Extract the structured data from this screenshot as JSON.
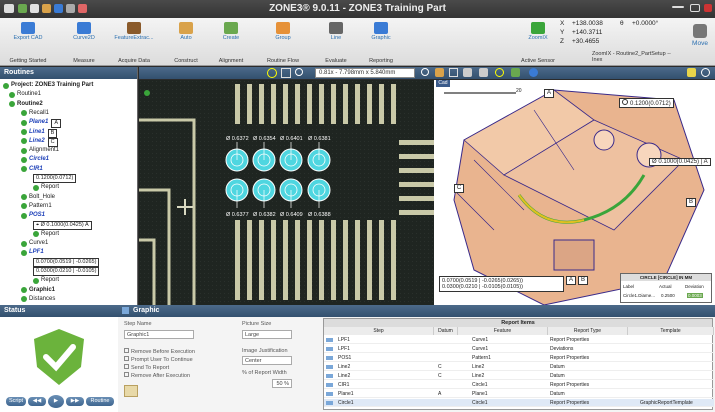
{
  "app": {
    "title": "ZONE3® 9.0.11 - ZONE3 Training Part"
  },
  "ribbon": {
    "groups": [
      {
        "icon": "export-cad-icon",
        "label": "Export CAD",
        "group": "Getting Started",
        "color": "#3a7bd5"
      },
      {
        "icon": "curve2d-icon",
        "label": "Curve2D",
        "group": "Measure",
        "color": "#3a7bd5"
      },
      {
        "icon": "feature-extract-icon",
        "label": "FeatureExtrac...",
        "group": "Acquire Data",
        "color": "#8a5a2a"
      },
      {
        "icon": "auto-icon",
        "label": "Auto",
        "group": "Construct",
        "color": "#d9a24a"
      },
      {
        "icon": "create-icon",
        "label": "Create",
        "group": "Alignment",
        "color": "#6aa84f"
      },
      {
        "icon": "group-icon",
        "label": "Group",
        "group": "Routine Flow",
        "color": "#e69138"
      },
      {
        "icon": "line-icon",
        "label": "Line",
        "group": "Evaluate",
        "color": "#666666"
      },
      {
        "icon": "graphic-icon",
        "label": "Graphic",
        "group": "Reporting",
        "color": "#3a7bd5"
      },
      {
        "icon": "zoom-icon",
        "label": "ZoomIX",
        "group": "Active Sensor",
        "color": "#3aa53a"
      }
    ],
    "readout": {
      "x": "+138.0038",
      "y": "+140.3711",
      "z": "+30.4655",
      "theta": "θ",
      "theta_val": "+0.0000°",
      "status": "ZoomIX - Routine2_PartSetup -- Inex"
    },
    "move_label": "Move"
  },
  "left": {
    "title": "Routines",
    "tree": [
      {
        "text": "Project: ZONE3 Training Part",
        "indent": 0,
        "style": "bold"
      },
      {
        "text": "Routine1",
        "indent": 1,
        "style": ""
      },
      {
        "text": "Routine2",
        "indent": 1,
        "style": "bold"
      },
      {
        "text": "Recall1",
        "indent": 3,
        "style": ""
      },
      {
        "text": "Plane1",
        "indent": 3,
        "style": "bl",
        "fcf": "A"
      },
      {
        "text": "Line1",
        "indent": 3,
        "style": "bl",
        "fcf": "B"
      },
      {
        "text": "Line2",
        "indent": 3,
        "style": "bl",
        "fcf": "C"
      },
      {
        "text": "Alignment1",
        "indent": 3,
        "style": ""
      },
      {
        "text": "Circle1",
        "indent": 3,
        "style": "bl"
      },
      {
        "text": "CIR1",
        "indent": 3,
        "style": "bl"
      },
      {
        "text": "0.1200(0.0712)",
        "indent": 5,
        "style": "fcf"
      },
      {
        "text": "Report",
        "indent": 5,
        "style": ""
      },
      {
        "text": "Bolt_Hole",
        "indent": 3,
        "style": ""
      },
      {
        "text": "Pattern1",
        "indent": 3,
        "style": ""
      },
      {
        "text": "POS1",
        "indent": 3,
        "style": "bl"
      },
      {
        "text": "⌖ Ø 0.1000(0.0425)  A",
        "indent": 5,
        "style": "fcf"
      },
      {
        "text": "Report",
        "indent": 5,
        "style": ""
      },
      {
        "text": "Curve1",
        "indent": 3,
        "style": ""
      },
      {
        "text": "LPF1",
        "indent": 3,
        "style": "bl"
      },
      {
        "text": "0.0700(0.0519 | -0.0265)",
        "indent": 5,
        "style": "fcf"
      },
      {
        "text": "0.0300(0.0210 | -0.0105)",
        "indent": 5,
        "style": "fcf"
      },
      {
        "text": "Report",
        "indent": 5,
        "style": ""
      },
      {
        "text": "Graphic1",
        "indent": 3,
        "style": "bold"
      },
      {
        "text": "Distances",
        "indent": 3,
        "style": ""
      }
    ]
  },
  "view": {
    "zoom_readout": "0.81x - 7.798mm x 5.840mm",
    "cam_labels": [
      "Ø 0.6372",
      "Ø 0.6354",
      "Ø 0.6401",
      "Ø 0.6381",
      "Ø 0.6377",
      "Ø 0.6382",
      "Ø 0.6409",
      "Ø 0.6388"
    ],
    "cad_fcf1": "0.1200(0.0712)",
    "cad_fcf2": "Ø 0.1000(0.0425)",
    "cad_fcf2_ref": "A",
    "cad_fcf3a": "0.0700(0.0519 | -0.0265(0.0265))",
    "cad_fcf3b": "0.0300(0.0210 | -0.0105(0.0105))",
    "cad_ref_a": "A",
    "cad_ref_b": "B",
    "cad_ref_c": "C",
    "cad_ref_box": "B",
    "cad_scale": "20",
    "cad_tab": "Cad",
    "cad_table": {
      "title": "CIRCLE [CIRCLE] IN MM",
      "headers": [
        "Label",
        "Actual",
        "Deviation"
      ],
      "row": [
        "Circle1.Diame...",
        "0.2500",
        "0.0003"
      ]
    }
  },
  "status": {
    "title": "Status",
    "buttons": [
      "Script",
      "◀◀",
      "▶",
      "▶▶",
      "Routine"
    ]
  },
  "graphic": {
    "title": "Graphic",
    "step_name_label": "Step Name",
    "step_name_value": "Graphic1",
    "pictsize_label": "Picture Size",
    "pictsize_value": "Large",
    "opt1": "Remove Before Execution",
    "opt2": "Prompt User To Continue",
    "opt3": "Send To Report",
    "opt4": "Remove After Execution",
    "justify_label": "Image Justification",
    "justify_value": "Center",
    "width_label": "% of Report Width",
    "width_value": "50 %",
    "report": {
      "title": "Report Items",
      "cols": [
        "Step",
        "Datum",
        "Feature",
        "Report Type",
        "Template"
      ],
      "rows": [
        [
          "LPF1",
          "",
          "Curve1",
          "Report Properties",
          ""
        ],
        [
          "LPF1",
          "",
          "Curve1",
          "Deviations",
          ""
        ],
        [
          "POS1",
          "",
          "Pattern1",
          "Report Properties",
          ""
        ],
        [
          "Line2",
          "C",
          "Line2",
          "Datum",
          ""
        ],
        [
          "Line2",
          "C",
          "Line2",
          "Datum",
          ""
        ],
        [
          "CIR1",
          "",
          "Circle1",
          "Report Properties",
          ""
        ],
        [
          "Plane1",
          "A",
          "Plane1",
          "Datum",
          ""
        ],
        [
          "Circle1",
          "",
          "Circle1",
          "Report Properties",
          "GraphicReportTemplate"
        ]
      ]
    }
  }
}
